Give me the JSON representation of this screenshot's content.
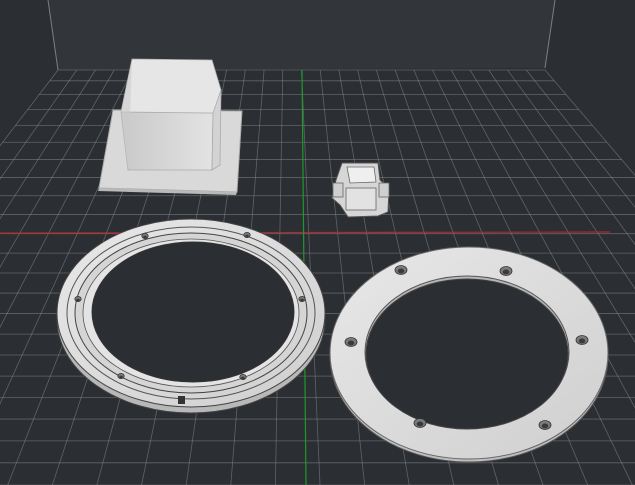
{
  "viewport": {
    "background_color": "#2b2e32",
    "grid_color": "#8a8f93",
    "x_axis_color": "#b3262b",
    "y_axis_color": "#1e9a2a",
    "model_color": "#dcdcdc"
  },
  "objects": [
    {
      "id": "box-on-flange",
      "kind": "square box with base flange"
    },
    {
      "id": "small-bracket",
      "kind": "small square clip"
    },
    {
      "id": "bearing-ring",
      "kind": "thick ring with inner race and 6 holes"
    },
    {
      "id": "mount-plate-ring",
      "kind": "flat ring with 6 countersunk holes"
    }
  ]
}
